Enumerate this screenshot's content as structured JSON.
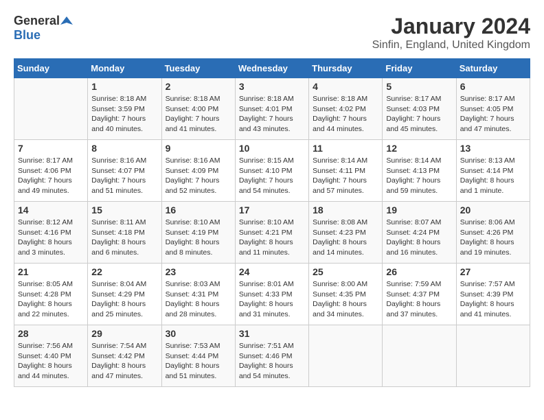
{
  "header": {
    "logo_general": "General",
    "logo_blue": "Blue",
    "month_year": "January 2024",
    "location": "Sinfin, England, United Kingdom"
  },
  "calendar": {
    "weekdays": [
      "Sunday",
      "Monday",
      "Tuesday",
      "Wednesday",
      "Thursday",
      "Friday",
      "Saturday"
    ],
    "weeks": [
      [
        {
          "day": "",
          "sunrise": "",
          "sunset": "",
          "daylight": ""
        },
        {
          "day": "1",
          "sunrise": "Sunrise: 8:18 AM",
          "sunset": "Sunset: 3:59 PM",
          "daylight": "Daylight: 7 hours and 40 minutes."
        },
        {
          "day": "2",
          "sunrise": "Sunrise: 8:18 AM",
          "sunset": "Sunset: 4:00 PM",
          "daylight": "Daylight: 7 hours and 41 minutes."
        },
        {
          "day": "3",
          "sunrise": "Sunrise: 8:18 AM",
          "sunset": "Sunset: 4:01 PM",
          "daylight": "Daylight: 7 hours and 43 minutes."
        },
        {
          "day": "4",
          "sunrise": "Sunrise: 8:18 AM",
          "sunset": "Sunset: 4:02 PM",
          "daylight": "Daylight: 7 hours and 44 minutes."
        },
        {
          "day": "5",
          "sunrise": "Sunrise: 8:17 AM",
          "sunset": "Sunset: 4:03 PM",
          "daylight": "Daylight: 7 hours and 45 minutes."
        },
        {
          "day": "6",
          "sunrise": "Sunrise: 8:17 AM",
          "sunset": "Sunset: 4:05 PM",
          "daylight": "Daylight: 7 hours and 47 minutes."
        }
      ],
      [
        {
          "day": "7",
          "sunrise": "Sunrise: 8:17 AM",
          "sunset": "Sunset: 4:06 PM",
          "daylight": "Daylight: 7 hours and 49 minutes."
        },
        {
          "day": "8",
          "sunrise": "Sunrise: 8:16 AM",
          "sunset": "Sunset: 4:07 PM",
          "daylight": "Daylight: 7 hours and 51 minutes."
        },
        {
          "day": "9",
          "sunrise": "Sunrise: 8:16 AM",
          "sunset": "Sunset: 4:09 PM",
          "daylight": "Daylight: 7 hours and 52 minutes."
        },
        {
          "day": "10",
          "sunrise": "Sunrise: 8:15 AM",
          "sunset": "Sunset: 4:10 PM",
          "daylight": "Daylight: 7 hours and 54 minutes."
        },
        {
          "day": "11",
          "sunrise": "Sunrise: 8:14 AM",
          "sunset": "Sunset: 4:11 PM",
          "daylight": "Daylight: 7 hours and 57 minutes."
        },
        {
          "day": "12",
          "sunrise": "Sunrise: 8:14 AM",
          "sunset": "Sunset: 4:13 PM",
          "daylight": "Daylight: 7 hours and 59 minutes."
        },
        {
          "day": "13",
          "sunrise": "Sunrise: 8:13 AM",
          "sunset": "Sunset: 4:14 PM",
          "daylight": "Daylight: 8 hours and 1 minute."
        }
      ],
      [
        {
          "day": "14",
          "sunrise": "Sunrise: 8:12 AM",
          "sunset": "Sunset: 4:16 PM",
          "daylight": "Daylight: 8 hours and 3 minutes."
        },
        {
          "day": "15",
          "sunrise": "Sunrise: 8:11 AM",
          "sunset": "Sunset: 4:18 PM",
          "daylight": "Daylight: 8 hours and 6 minutes."
        },
        {
          "day": "16",
          "sunrise": "Sunrise: 8:10 AM",
          "sunset": "Sunset: 4:19 PM",
          "daylight": "Daylight: 8 hours and 8 minutes."
        },
        {
          "day": "17",
          "sunrise": "Sunrise: 8:10 AM",
          "sunset": "Sunset: 4:21 PM",
          "daylight": "Daylight: 8 hours and 11 minutes."
        },
        {
          "day": "18",
          "sunrise": "Sunrise: 8:08 AM",
          "sunset": "Sunset: 4:23 PM",
          "daylight": "Daylight: 8 hours and 14 minutes."
        },
        {
          "day": "19",
          "sunrise": "Sunrise: 8:07 AM",
          "sunset": "Sunset: 4:24 PM",
          "daylight": "Daylight: 8 hours and 16 minutes."
        },
        {
          "day": "20",
          "sunrise": "Sunrise: 8:06 AM",
          "sunset": "Sunset: 4:26 PM",
          "daylight": "Daylight: 8 hours and 19 minutes."
        }
      ],
      [
        {
          "day": "21",
          "sunrise": "Sunrise: 8:05 AM",
          "sunset": "Sunset: 4:28 PM",
          "daylight": "Daylight: 8 hours and 22 minutes."
        },
        {
          "day": "22",
          "sunrise": "Sunrise: 8:04 AM",
          "sunset": "Sunset: 4:29 PM",
          "daylight": "Daylight: 8 hours and 25 minutes."
        },
        {
          "day": "23",
          "sunrise": "Sunrise: 8:03 AM",
          "sunset": "Sunset: 4:31 PM",
          "daylight": "Daylight: 8 hours and 28 minutes."
        },
        {
          "day": "24",
          "sunrise": "Sunrise: 8:01 AM",
          "sunset": "Sunset: 4:33 PM",
          "daylight": "Daylight: 8 hours and 31 minutes."
        },
        {
          "day": "25",
          "sunrise": "Sunrise: 8:00 AM",
          "sunset": "Sunset: 4:35 PM",
          "daylight": "Daylight: 8 hours and 34 minutes."
        },
        {
          "day": "26",
          "sunrise": "Sunrise: 7:59 AM",
          "sunset": "Sunset: 4:37 PM",
          "daylight": "Daylight: 8 hours and 37 minutes."
        },
        {
          "day": "27",
          "sunrise": "Sunrise: 7:57 AM",
          "sunset": "Sunset: 4:39 PM",
          "daylight": "Daylight: 8 hours and 41 minutes."
        }
      ],
      [
        {
          "day": "28",
          "sunrise": "Sunrise: 7:56 AM",
          "sunset": "Sunset: 4:40 PM",
          "daylight": "Daylight: 8 hours and 44 minutes."
        },
        {
          "day": "29",
          "sunrise": "Sunrise: 7:54 AM",
          "sunset": "Sunset: 4:42 PM",
          "daylight": "Daylight: 8 hours and 47 minutes."
        },
        {
          "day": "30",
          "sunrise": "Sunrise: 7:53 AM",
          "sunset": "Sunset: 4:44 PM",
          "daylight": "Daylight: 8 hours and 51 minutes."
        },
        {
          "day": "31",
          "sunrise": "Sunrise: 7:51 AM",
          "sunset": "Sunset: 4:46 PM",
          "daylight": "Daylight: 8 hours and 54 minutes."
        },
        {
          "day": "",
          "sunrise": "",
          "sunset": "",
          "daylight": ""
        },
        {
          "day": "",
          "sunrise": "",
          "sunset": "",
          "daylight": ""
        },
        {
          "day": "",
          "sunrise": "",
          "sunset": "",
          "daylight": ""
        }
      ]
    ]
  }
}
